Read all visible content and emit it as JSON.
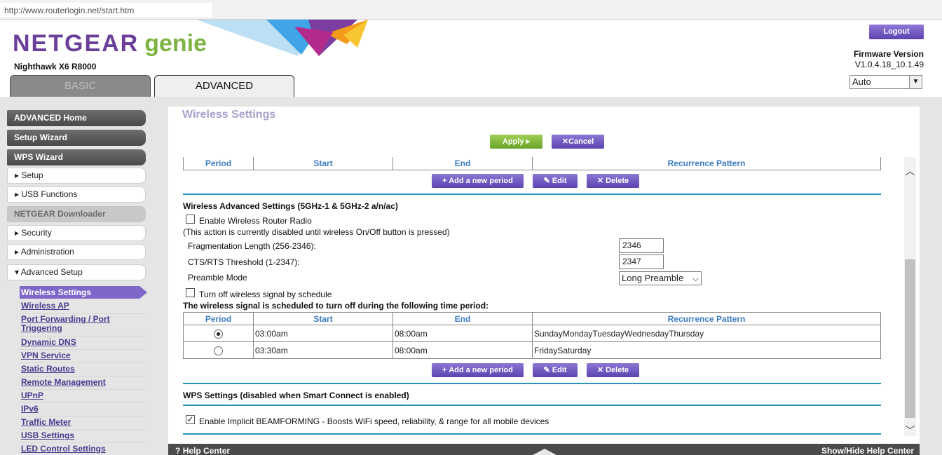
{
  "browser": {
    "url": "http://www.routerlogin.net/start.htm"
  },
  "header": {
    "brand": "NETGEAR",
    "brand_sub": "genie",
    "model": "Nighthawk X6 R8000",
    "tabs": {
      "basic": "BASIC",
      "advanced": "ADVANCED"
    },
    "logout": "Logout",
    "firmware_label": "Firmware Version",
    "firmware_value": "V1.0.4.18_10.1.49",
    "language": "Auto"
  },
  "sidebar": {
    "advanced_home": "ADVANCED Home",
    "setup_wizard": "Setup Wizard",
    "wps_wizard": "WPS Wizard",
    "setup": "▸ Setup",
    "usb_functions": "▸ USB Functions",
    "netgear_downloader": "NETGEAR Downloader",
    "security": "▸ Security",
    "administration": "▸ Administration",
    "advanced_setup": "▾ Advanced Setup",
    "sub": {
      "wireless_settings": "Wireless Settings",
      "wireless_ap": "Wireless AP",
      "port_forwarding_1": "Port Forwarding / Port",
      "port_forwarding_2": "Triggering",
      "dynamic_dns": "Dynamic DNS",
      "vpn_service": "VPN Service",
      "static_routes": "Static Routes",
      "remote_management": "Remote Management",
      "upnp": "UPnP",
      "ipv6": "IPv6",
      "traffic_meter": "Traffic Meter",
      "usb_settings": "USB Settings",
      "led_control": "LED Control Settings"
    }
  },
  "main": {
    "title": "Wireless Settings",
    "apply": "Apply ▸",
    "cancel": "✕Cancel",
    "columns": {
      "period": "Period",
      "start": "Start",
      "end": "End",
      "recurrence": "Recurrence Pattern"
    },
    "add_period": "+ Add a new period",
    "edit": "✎ Edit",
    "delete": "✕ Delete",
    "adv_title": "Wireless Advanced Settings (5GHz-1 & 5GHz-2 a/n/ac)",
    "enable_radio": "Enable Wireless Router Radio",
    "disabled_note": "(This action is currently disabled until wireless On/Off button is pressed)",
    "frag_label": "Fragmentation Length (256-2346):",
    "frag_value": "2346",
    "cts_label": "CTS/RTS Threshold (1-2347):",
    "cts_value": "2347",
    "preamble_label": "Preamble Mode",
    "preamble_value": "Long Preamble",
    "schedule_toggle": "Turn off wireless signal by schedule",
    "schedule_note": "The wireless signal is scheduled to turn off during the following time period:",
    "schedule_rows": [
      {
        "start": "03:00am",
        "end": "08:00am",
        "pattern": "SundayMondayTuesdayWednesdayThursday",
        "selected": true
      },
      {
        "start": "03:30am",
        "end": "08:00am",
        "pattern": "FridaySaturday",
        "selected": false
      }
    ],
    "wps_title": "WPS Settings (disabled when Smart Connect is enabled)",
    "beamforming": "Enable Implicit BEAMFORMING - Boosts WiFi speed, reliability, & range for all mobile devices"
  },
  "footer": {
    "help_center": "Help Center",
    "toggle_help": "Show/Hide Help Center"
  },
  "colors": {
    "accent_purple": "#6a3f99",
    "accent_green": "#7cb342",
    "divider_blue": "#2a94b8",
    "header_blue": "#3b7bbf"
  }
}
